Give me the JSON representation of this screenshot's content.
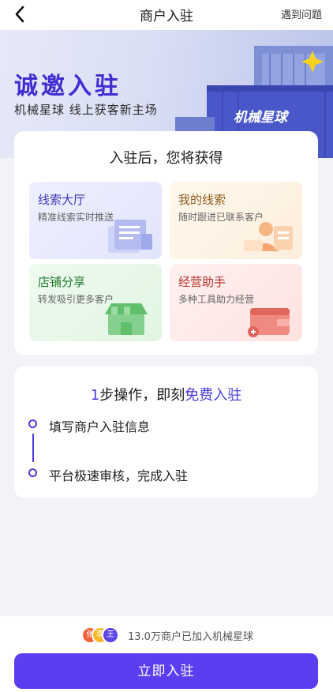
{
  "nav": {
    "title": "商户入驻",
    "help": "遇到问题"
  },
  "hero": {
    "title": "诚邀入驻",
    "subtitle": "机械星球 线上获客新主场",
    "container_text": "机械星球"
  },
  "benefits": {
    "title": "入驻后，您将获得",
    "tiles": [
      {
        "title": "线索大厅",
        "subtitle": "精准线索实时推送"
      },
      {
        "title": "我的线索",
        "subtitle": "随时跟进已联系客户"
      },
      {
        "title": "店铺分享",
        "subtitle": "转发吸引更多客户"
      },
      {
        "title": "经营助手",
        "subtitle": "多种工具助力经营"
      }
    ]
  },
  "steps": {
    "title_num": "1",
    "title_mid": "步操作，即刻",
    "title_accent": "免费入驻",
    "items": [
      "填写商户入驻信息",
      "平台极速审核，完成入驻"
    ]
  },
  "footer": {
    "avatars": [
      "张",
      "李",
      "王"
    ],
    "joined_text": "13.0万商户已加入机械星球",
    "cta_label": "立即入驻"
  },
  "colors": {
    "brand": "#5b3ef0",
    "accent_text": "#4a3ae0"
  }
}
